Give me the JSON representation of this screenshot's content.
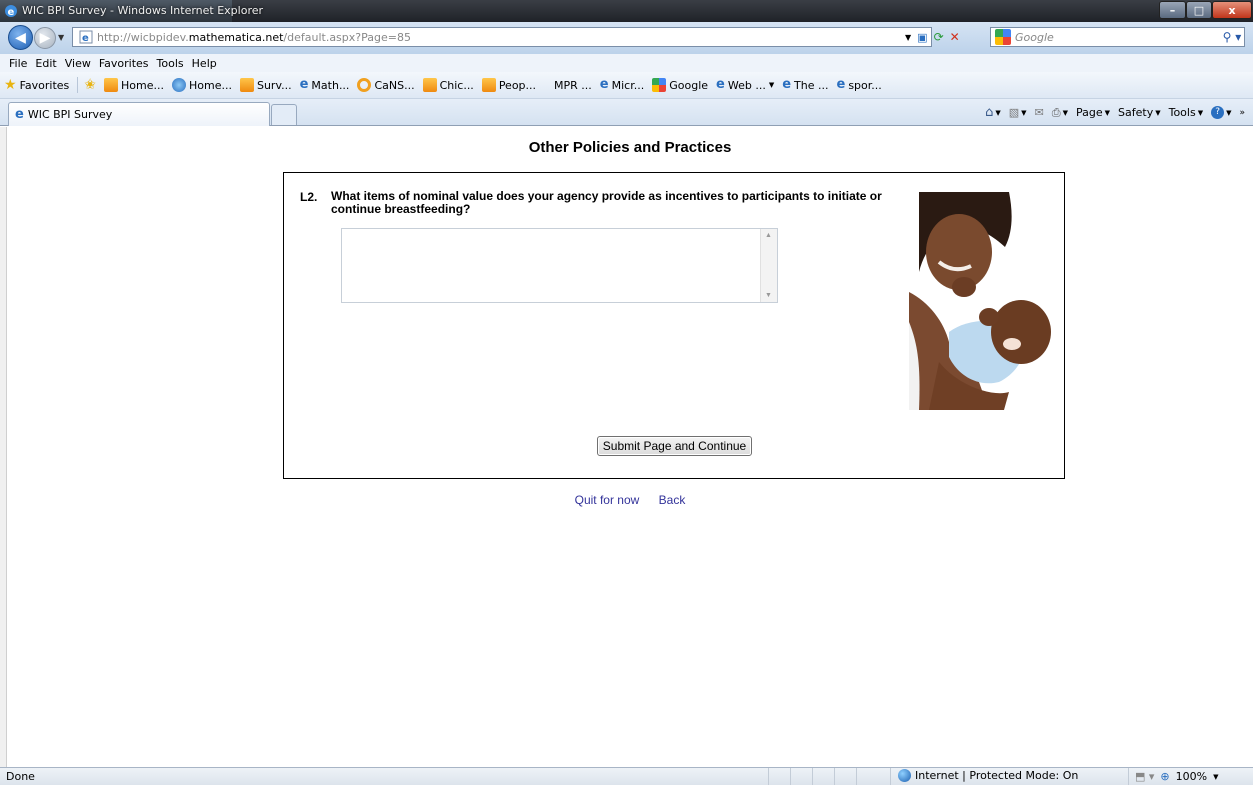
{
  "window": {
    "title": "WIC BPI Survey - Windows Internet Explorer",
    "controls": {
      "minimize": "–",
      "maximize": "□",
      "close": "x"
    }
  },
  "address": {
    "url_prefix": "http://wicbpidev.",
    "url_domain": "mathematica.net",
    "url_path": "/default.aspx?Page=85",
    "search_placeholder": "Google"
  },
  "menu": {
    "items": [
      "File",
      "Edit",
      "View",
      "Favorites",
      "Tools",
      "Help"
    ]
  },
  "favorites_bar": {
    "favorites_label": "Favorites",
    "items": [
      {
        "label": "Home...",
        "icon": "orange-feed-icon"
      },
      {
        "label": "Home...",
        "icon": "blue-globe-icon"
      },
      {
        "label": "Surv...",
        "icon": "orange-feed-icon"
      },
      {
        "label": "Math...",
        "icon": "ie-page-icon"
      },
      {
        "label": "CaNS...",
        "icon": "ring-icon"
      },
      {
        "label": "Chic...",
        "icon": "orange-feed-icon"
      },
      {
        "label": "Peop...",
        "icon": "orange-feed-icon"
      },
      {
        "label": "MPR ...",
        "icon": "none"
      },
      {
        "label": "Micr...",
        "icon": "ie-page-icon"
      },
      {
        "label": "Google",
        "icon": "google-icon"
      },
      {
        "label": "Web ...",
        "icon": "ie-page-icon"
      },
      {
        "label": "The ...",
        "icon": "ie-page-icon"
      },
      {
        "label": "spor...",
        "icon": "ie-page-icon"
      }
    ]
  },
  "tabs": {
    "active_label": "WIC BPI Survey"
  },
  "command_bar": {
    "page": "Page",
    "safety": "Safety",
    "tools": "Tools"
  },
  "page": {
    "title": "Other Policies and Practices",
    "question_number": "L2.",
    "question_text": "What items of nominal value does your agency provide as incentives to participants to initiate or continue breastfeeding?",
    "answer_value": "",
    "submit_label": "Submit Page and Continue",
    "links": {
      "quit": "Quit for now",
      "back": "Back"
    }
  },
  "status": {
    "text": "Done",
    "zone": "Internet | Protected Mode: On",
    "zoom": "100%"
  },
  "colors": {
    "link": "#33339a",
    "chrome_blue": "#bcd2ea"
  }
}
